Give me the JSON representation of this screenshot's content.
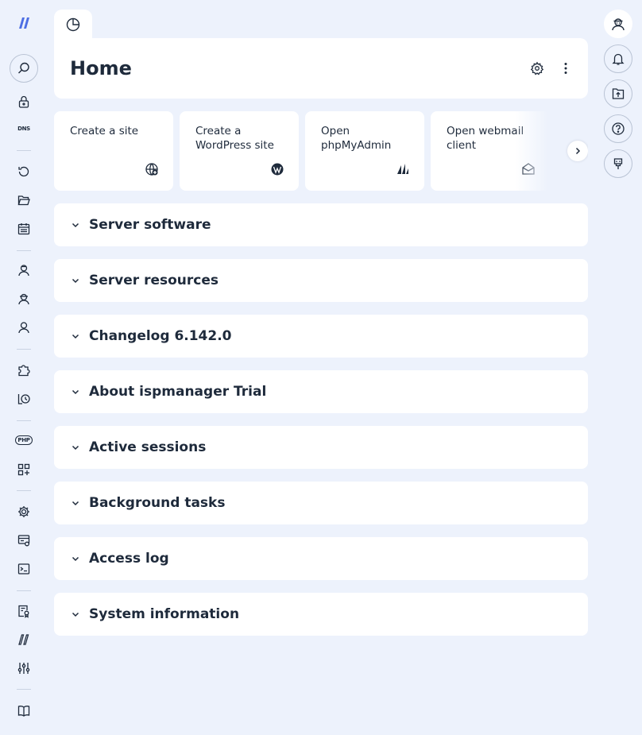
{
  "page": {
    "title": "Home"
  },
  "sidebar": {
    "dns_label": "DNS",
    "php_label": "PHP",
    "items": [
      "lock-icon",
      "dns-icon",
      "backup-icon",
      "folder-icon",
      "calendar-icon",
      "admin-user-icon",
      "reseller-icon",
      "user-icon",
      "extension-icon",
      "cron-icon",
      "php-icon",
      "apps-icon",
      "gear-icon",
      "server-settings-icon",
      "terminal-icon",
      "certificate-icon",
      "ispmanager-logo-icon",
      "sliders-icon",
      "docs-book-icon"
    ]
  },
  "quick_actions": [
    {
      "label": "Create a site",
      "icon": "globe-plus-icon"
    },
    {
      "label": "Create a WordPress site",
      "icon": "wordpress-icon"
    },
    {
      "label": "Open phpMyAdmin",
      "icon": "phpmyadmin-icon"
    },
    {
      "label": "Open webmail client",
      "icon": "webmail-icon"
    }
  ],
  "sections": [
    {
      "title": "Server software"
    },
    {
      "title": "Server resources"
    },
    {
      "title": "Changelog 6.142.0"
    },
    {
      "title": "About ispmanager Trial"
    },
    {
      "title": "Active sessions"
    },
    {
      "title": "Background tasks"
    },
    {
      "title": "Access log"
    },
    {
      "title": "System information"
    }
  ],
  "colors": {
    "background": "#edf2fc",
    "card": "#ffffff",
    "text": "#1e2a3b",
    "logo": "#4d6ee3"
  }
}
